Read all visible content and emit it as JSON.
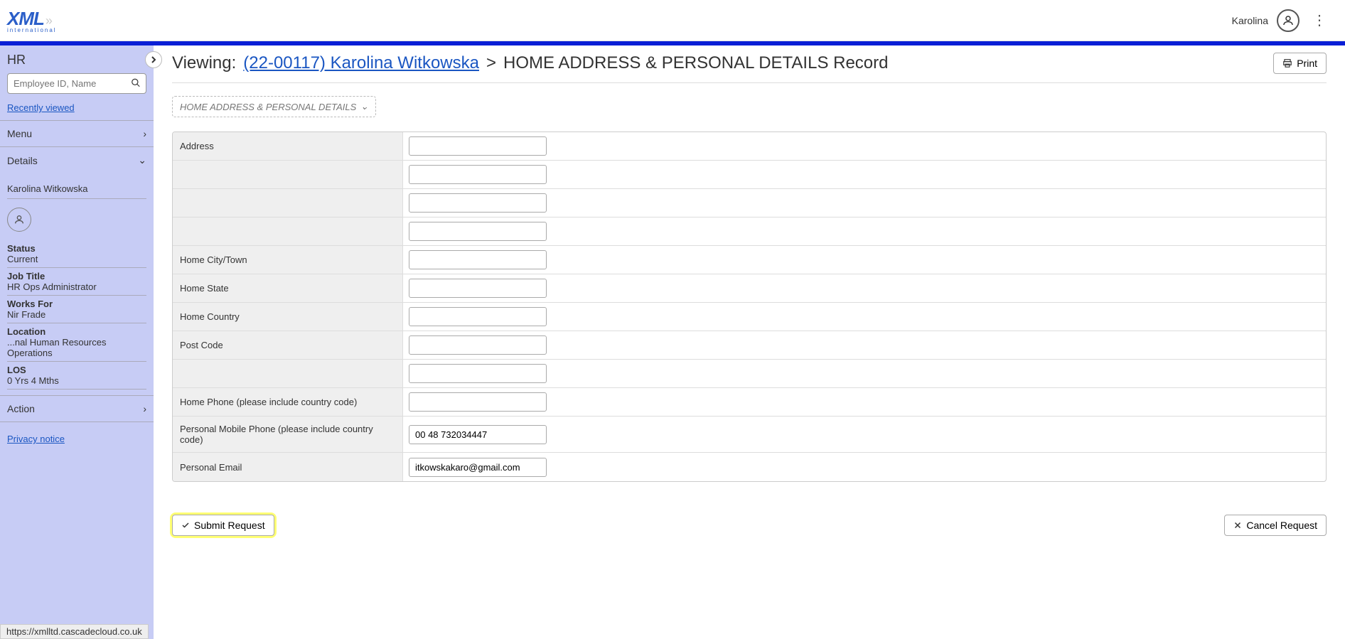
{
  "topbar": {
    "logo_main": "XML",
    "logo_sub": "international",
    "username": "Karolina"
  },
  "sidebar": {
    "title": "HR",
    "search_placeholder": "Employee ID, Name",
    "recently_viewed": "Recently viewed",
    "menu": "Menu",
    "details": "Details",
    "employee_name": "Karolina Witkowska",
    "items": [
      {
        "label": "Status",
        "value": "Current"
      },
      {
        "label": "Job Title",
        "value": "HR Ops Administrator"
      },
      {
        "label": "Works For",
        "value": "Nir Frade"
      },
      {
        "label": "Location",
        "value": "...nal Human Resources Operations"
      },
      {
        "label": "LOS",
        "value": "0 Yrs 4 Mths"
      }
    ],
    "action": "Action",
    "privacy": "Privacy notice"
  },
  "main": {
    "viewing_label": "Viewing:",
    "record_link": "(22-00117) Karolina Witkowska",
    "separator": ">",
    "record_title": "HOME ADDRESS & PERSONAL DETAILS Record",
    "print": "Print",
    "crumb": "HOME ADDRESS & PERSONAL DETAILS",
    "fields": [
      {
        "label": "Address",
        "value": ""
      },
      {
        "label": "",
        "value": ""
      },
      {
        "label": "",
        "value": ""
      },
      {
        "label": "",
        "value": ""
      },
      {
        "label": "Home City/Town",
        "value": ""
      },
      {
        "label": "Home State",
        "value": ""
      },
      {
        "label": "Home Country",
        "value": ""
      },
      {
        "label": "Post Code",
        "value": ""
      },
      {
        "label": "",
        "value": ""
      },
      {
        "label": "Home Phone (please include country code)",
        "value": ""
      },
      {
        "label": "Personal Mobile Phone (please include country code)",
        "value": "00 48 732034447"
      },
      {
        "label": "Personal Email",
        "value": "itkowskakaro@gmail.com"
      }
    ],
    "submit": "Submit Request",
    "cancel": "Cancel Request"
  },
  "status_url": "https://xmlltd.cascadecloud.co.uk"
}
